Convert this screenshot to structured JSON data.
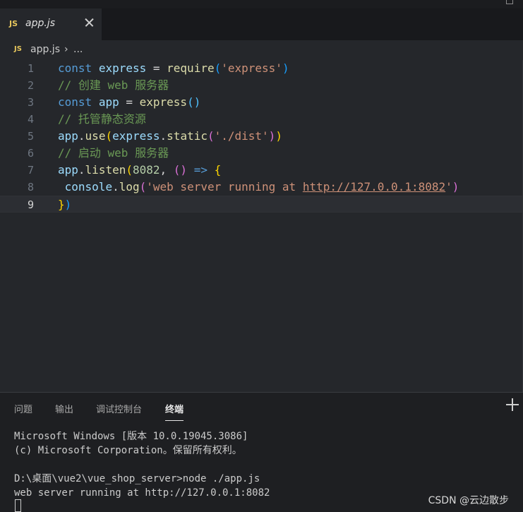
{
  "tab": {
    "badge": "JS",
    "label": "app.js"
  },
  "breadcrumb": {
    "badge": "JS",
    "file": "app.js",
    "separator": "›",
    "more": "..."
  },
  "editor": {
    "lines": [
      {
        "n": "1",
        "tokens": [
          [
            "kw",
            "const"
          ],
          [
            "op",
            " "
          ],
          [
            "var",
            "express"
          ],
          [
            "op",
            " = "
          ],
          [
            "fn",
            "require"
          ],
          [
            "p3",
            "("
          ],
          [
            "str",
            "'express'"
          ],
          [
            "p3",
            ")"
          ]
        ]
      },
      {
        "n": "2",
        "tokens": [
          [
            "cmt",
            "// 创建 web 服务器"
          ]
        ]
      },
      {
        "n": "3",
        "tokens": [
          [
            "kw",
            "const"
          ],
          [
            "op",
            " "
          ],
          [
            "var",
            "app"
          ],
          [
            "op",
            " = "
          ],
          [
            "fn",
            "express"
          ],
          [
            "p4",
            "()"
          ]
        ]
      },
      {
        "n": "4",
        "tokens": [
          [
            "cmt",
            "// 托管静态资源"
          ]
        ]
      },
      {
        "n": "5",
        "tokens": [
          [
            "var",
            "app"
          ],
          [
            "op",
            "."
          ],
          [
            "fn",
            "use"
          ],
          [
            "p1",
            "("
          ],
          [
            "var",
            "express"
          ],
          [
            "op",
            "."
          ],
          [
            "fn",
            "static"
          ],
          [
            "p2",
            "("
          ],
          [
            "str",
            "'./dist'"
          ],
          [
            "p2",
            ")"
          ],
          [
            "p1",
            ")"
          ]
        ]
      },
      {
        "n": "6",
        "tokens": [
          [
            "cmt",
            "// 启动 web 服务器"
          ]
        ]
      },
      {
        "n": "7",
        "tokens": [
          [
            "var",
            "app"
          ],
          [
            "op",
            "."
          ],
          [
            "fn",
            "listen"
          ],
          [
            "p1",
            "("
          ],
          [
            "num",
            "8082"
          ],
          [
            "op",
            ", "
          ],
          [
            "p2",
            "()"
          ],
          [
            "op",
            " "
          ],
          [
            "kw",
            "=>"
          ],
          [
            "op",
            " "
          ],
          [
            "p1",
            "{"
          ]
        ]
      },
      {
        "n": "8",
        "tokens": [
          [
            "op",
            " "
          ],
          [
            "var",
            "console"
          ],
          [
            "op",
            "."
          ],
          [
            "fn",
            "log"
          ],
          [
            "p2",
            "("
          ],
          [
            "str",
            "'web server running at "
          ],
          [
            "url",
            "http://127.0.0.1:8082"
          ],
          [
            "str",
            "'"
          ],
          [
            "p2",
            ")"
          ]
        ]
      },
      {
        "n": "9",
        "tokens": [
          [
            "p1",
            "}"
          ],
          [
            "p3",
            ")"
          ]
        ]
      }
    ],
    "current_line": "9"
  },
  "panel": {
    "tabs": [
      "问题",
      "输出",
      "调试控制台",
      "终端"
    ],
    "active_tab": "终端",
    "terminal_lines": [
      "Microsoft Windows [版本 10.0.19045.3086]",
      "(c) Microsoft Corporation。保留所有权利。",
      "",
      "D:\\桌面\\vue2\\vue_shop_server>node ./app.js",
      "web server running at http://127.0.0.1:8082"
    ]
  },
  "watermark": "CSDN @云边散步",
  "colors": {
    "editor_bg": "#25272b",
    "panel_bg": "#1e1f22",
    "accent_js": "#e6c65c"
  }
}
